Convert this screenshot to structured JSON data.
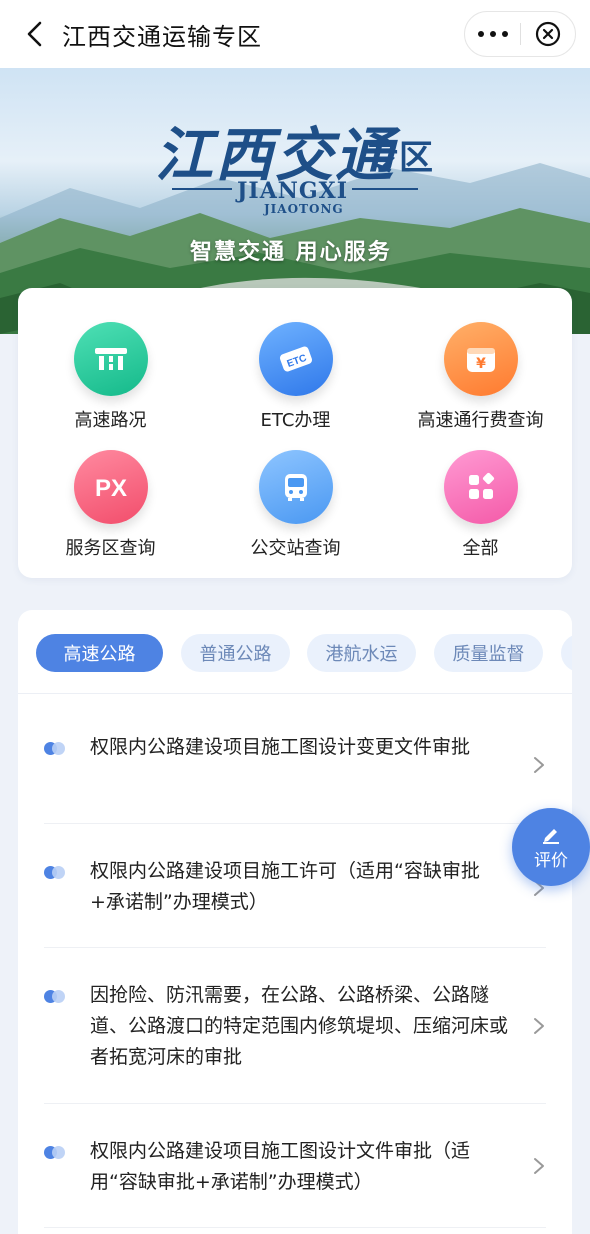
{
  "header": {
    "title": "江西交通运输专区"
  },
  "banner": {
    "title": "江西交通",
    "zone": "专区",
    "en_line1": "JIANGXI",
    "en_line2": "JIAOTONG",
    "slogan": "智慧交通 用心服务"
  },
  "services": [
    {
      "label": "高速路况",
      "icon": "highway-icon",
      "color_from": "#4fe0b5",
      "color_to": "#14b98a"
    },
    {
      "label": "ETC办理",
      "icon": "etc-card-icon",
      "color_from": "#6fb2ff",
      "color_to": "#2f78ea"
    },
    {
      "label": "高速通行费查询",
      "icon": "toll-fee-icon",
      "color_from": "#ffb069",
      "color_to": "#ff7a2f"
    },
    {
      "label": "服务区查询",
      "icon": "service-area-icon",
      "color_from": "#ff8aa0",
      "color_to": "#f24d6b"
    },
    {
      "label": "公交站查询",
      "icon": "bus-icon",
      "color_from": "#8ec5ff",
      "color_to": "#4a98f2"
    },
    {
      "label": "全部",
      "icon": "apps-grid-icon",
      "color_from": "#ff9ad3",
      "color_to": "#f45aa8"
    }
  ],
  "tabs": [
    {
      "label": "高速公路",
      "active": true
    },
    {
      "label": "普通公路",
      "active": false
    },
    {
      "label": "港航水运",
      "active": false
    },
    {
      "label": "质量监督",
      "active": false
    },
    {
      "label": "不",
      "active": false
    }
  ],
  "items": [
    {
      "text": "权限内公路建设项目施工图设计变更文件审批"
    },
    {
      "text": "权限内公路建设项目施工许可（适用“容缺审批+承诺制”办理模式）"
    },
    {
      "text": "因抢险、防汛需要，在公路、公路桥梁、公路隧道、公路渡口的特定范围内修筑堤坝、压缩河床或者拓宽河床的审批"
    },
    {
      "text": "权限内公路建设项目施工图设计文件审批（适用“容缺审批+承诺制”办理模式）"
    }
  ],
  "fab": {
    "label": "评价"
  },
  "colors": {
    "accent": "#4e83e3",
    "tab_bg": "#eaf1fc",
    "tab_text": "#6d89b8"
  }
}
